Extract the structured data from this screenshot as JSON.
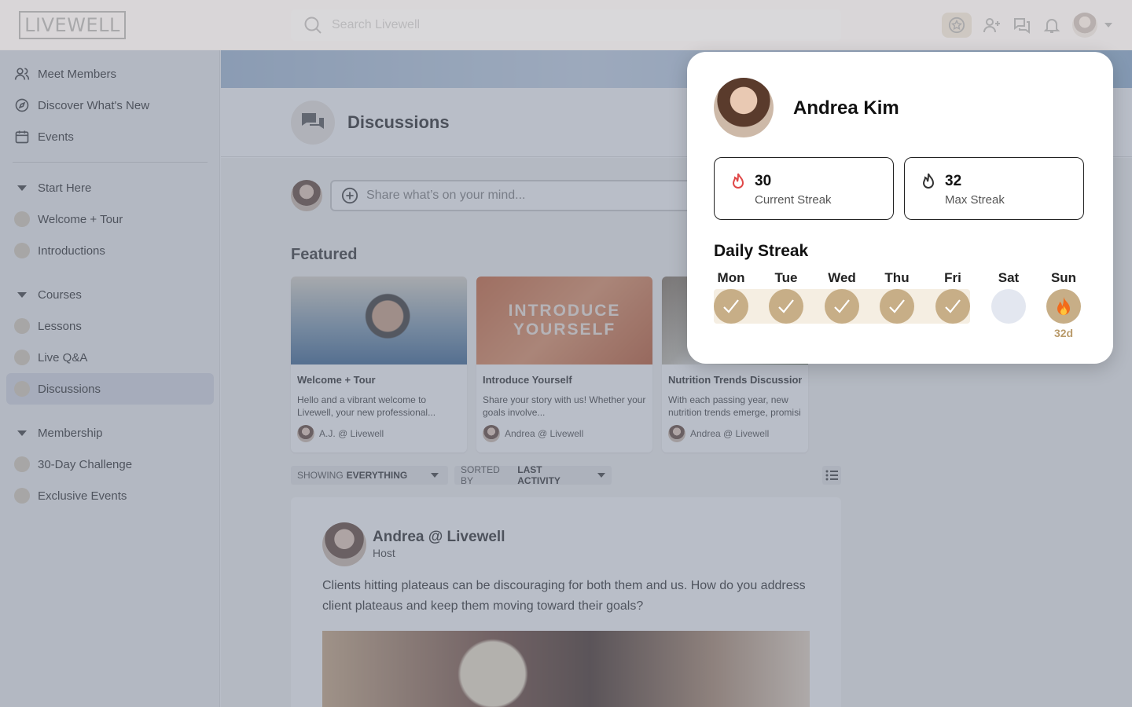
{
  "app": {
    "logo_text": "LIVEWELL",
    "search_placeholder": "Search Livewell",
    "top_icons": [
      "streak-star-icon",
      "add-user-icon",
      "messages-icon",
      "bell-icon",
      "user-avatar",
      "chevron-down-icon"
    ]
  },
  "sidebar": {
    "top_items": [
      {
        "label": "Meet Members",
        "icon": "users-icon"
      },
      {
        "label": "Discover What's New",
        "icon": "compass-icon"
      },
      {
        "label": "Events",
        "icon": "calendar-icon"
      }
    ],
    "groups": [
      {
        "label": "Start Here",
        "items": [
          "Welcome + Tour",
          "Introductions"
        ]
      },
      {
        "label": "Courses",
        "items": [
          "Lessons",
          "Live Q&A",
          "Discussions"
        ]
      },
      {
        "label": "Membership",
        "items": [
          "30-Day Challenge",
          "Exclusive Events"
        ]
      }
    ],
    "active_item": "Discussions"
  },
  "main": {
    "page_title": "Discussions",
    "composer_placeholder": "Share what’s on your mind...",
    "featured_label": "Featured",
    "cards": [
      {
        "title": "Welcome + Tour",
        "desc": "Hello and a vibrant welcome to Livewell, your new professional...",
        "author": "A.J. @ Livewell"
      },
      {
        "title": "Introduce Yourself",
        "image_text_1": "INTRODUCE",
        "image_text_2": "YOURSELF",
        "desc": "Share your story with us! Whether your goals involve...",
        "author": "Andrea @ Livewell"
      },
      {
        "title": "Nutrition Trends Discussion",
        "desc": "With each passing year, new nutrition trends emerge, promisi",
        "author": "Andrea @ Livewell"
      }
    ],
    "filters": {
      "showing_prefix": "SHOWING",
      "showing_value": "EVERYTHING",
      "sorted_prefix": "SORTED BY",
      "sorted_value": "LAST ACTIVITY"
    },
    "post": {
      "author": "Andrea @ Livewell",
      "role": "Host",
      "body": "Clients hitting plateaus can be discouraging for both them and us. How do you address client plateaus and keep them moving toward their goals?"
    }
  },
  "popup": {
    "name": "Andrea Kim",
    "current_streak": {
      "value": "30",
      "label": "Current Streak"
    },
    "max_streak": {
      "value": "32",
      "label": "Max Streak"
    },
    "daily_title": "Daily Streak",
    "days": [
      {
        "label": "Mon",
        "state": "done"
      },
      {
        "label": "Tue",
        "state": "done"
      },
      {
        "label": "Wed",
        "state": "done"
      },
      {
        "label": "Thu",
        "state": "done"
      },
      {
        "label": "Fri",
        "state": "done"
      },
      {
        "label": "Sat",
        "state": "empty"
      },
      {
        "label": "Sun",
        "state": "today",
        "note": "32d"
      }
    ],
    "accent_color": "#c7ae87",
    "current_streak_icon_color": "#e04848"
  }
}
